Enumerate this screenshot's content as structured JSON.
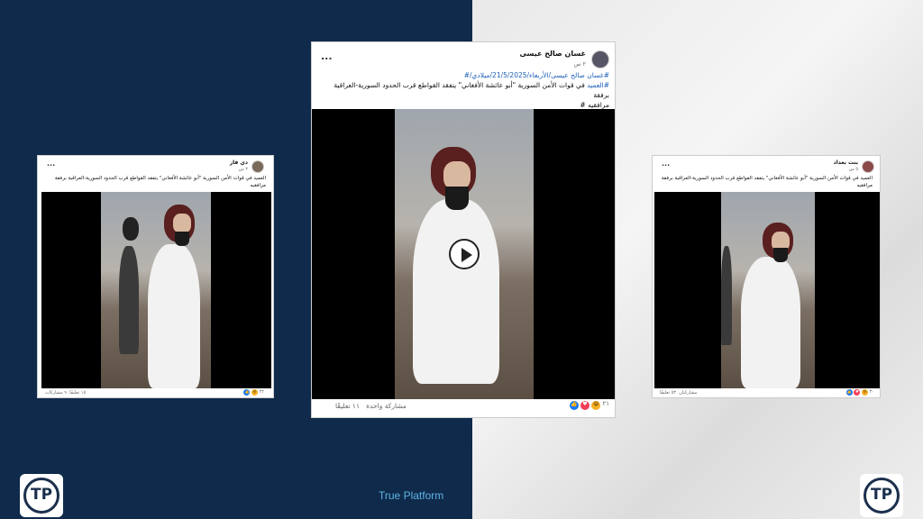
{
  "brand": {
    "name": "True Platform",
    "logo_text": "TP"
  },
  "posts": {
    "center": {
      "author": "غسان صالح عيسى",
      "time": "٢ س",
      "more": "...",
      "caption_line1": "#غسان صالح عيسى/الأربعاء/21/5/2025/ميلادي/#",
      "caption_tag": "#العميد",
      "caption_line2": " في قوات الأمن السورية \"أبو عائشة الأفغاني\" يتفقد القواطع قرب الحدود السورية-العراقية برفقة",
      "caption_line3": "مرافقيه #",
      "reaction_count": "٢١",
      "comments": "١١ تعليقًا",
      "shares": "مشاركة واحدة"
    },
    "left": {
      "author": "دي فاز",
      "time": "٢ س",
      "more": "...",
      "caption": "العميد في قوات الأمن السورية \"أبو عائشة الأفغاني\" يتفقد القواطع قرب الحدود السورية-العراقية برفقة مرافقيه",
      "reaction_count": "٣٢",
      "comments": "١٥ تعليقًا",
      "shares": "٩ مشاركات"
    },
    "right": {
      "author": "بنت بغداد",
      "time": "٥ س",
      "more": "...",
      "caption": "العميد في قوات الأمن السورية \"أبو عائشة الأفغاني\" يتفقد القواطع قرب الحدود السورية-العراقية برفقة مرافقيه",
      "reaction_count": "٣٠",
      "comments": "٥٣ تعليقًا",
      "shares": "مشاركتان"
    }
  },
  "colors": {
    "left_bg": "#0f2a4a",
    "brand_text": "#5fb4e6",
    "link": "#1c5fb8"
  }
}
